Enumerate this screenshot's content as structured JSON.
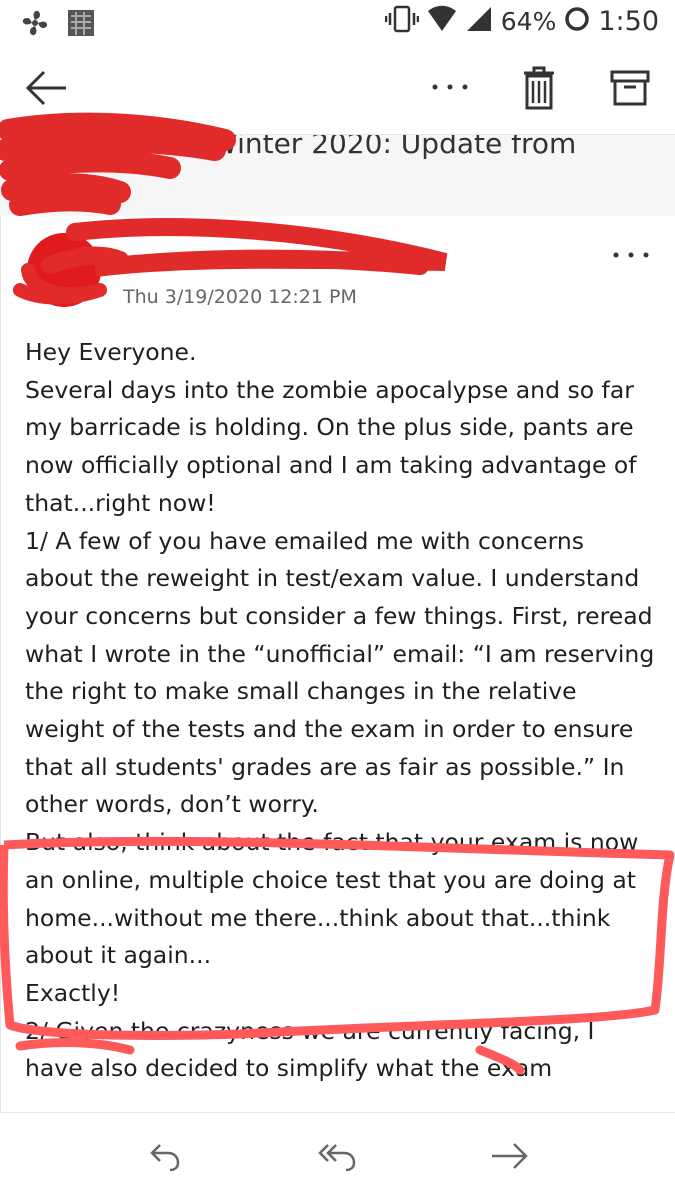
{
  "status_bar": {
    "battery_percent": "64%",
    "time": "1:50",
    "icons": [
      "fan-icon",
      "image-icon",
      "vibrate-icon",
      "wifi-icon",
      "signal-icon",
      "battery-icon"
    ]
  },
  "app_bar": {
    "icons": [
      "back-arrow-icon",
      "more-options-icon",
      "trash-icon",
      "archive-icon"
    ]
  },
  "email": {
    "subject_visible": "Winter 2020: Update from",
    "date": "Thu 3/19/2020 12:21 PM",
    "body": [
      "Hey Everyone.",
      "Several days into the zombie apocalypse and so far my barricade is holding. On the plus side, pants are now officially optional and I am taking advantage of that...right now!",
      "1/ A few of you have emailed me with concerns about the reweight in test/exam value. I understand your concerns but consider a few things. First, reread what I wrote in the “unofficial” email: “I am reserving the right to make small changes in the relative weight of the tests and the exam in order to ensure that all students' grades are as fair as possible.” In other words, don’t worry.",
      "But also, think about the fact that your exam is now an online, multiple choice test that you are doing at home...without me there...think about that...think about it again...",
      "Exactly!",
      "2/ Given the crazyness we are currently facing, I have also decided to simplify what the exam"
    ]
  },
  "bottom_bar": {
    "icons": [
      "reply-icon",
      "reply-all-icon",
      "forward-icon"
    ]
  },
  "colors": {
    "redaction": "#e11b1b",
    "annotation": "#ff5a5a"
  }
}
